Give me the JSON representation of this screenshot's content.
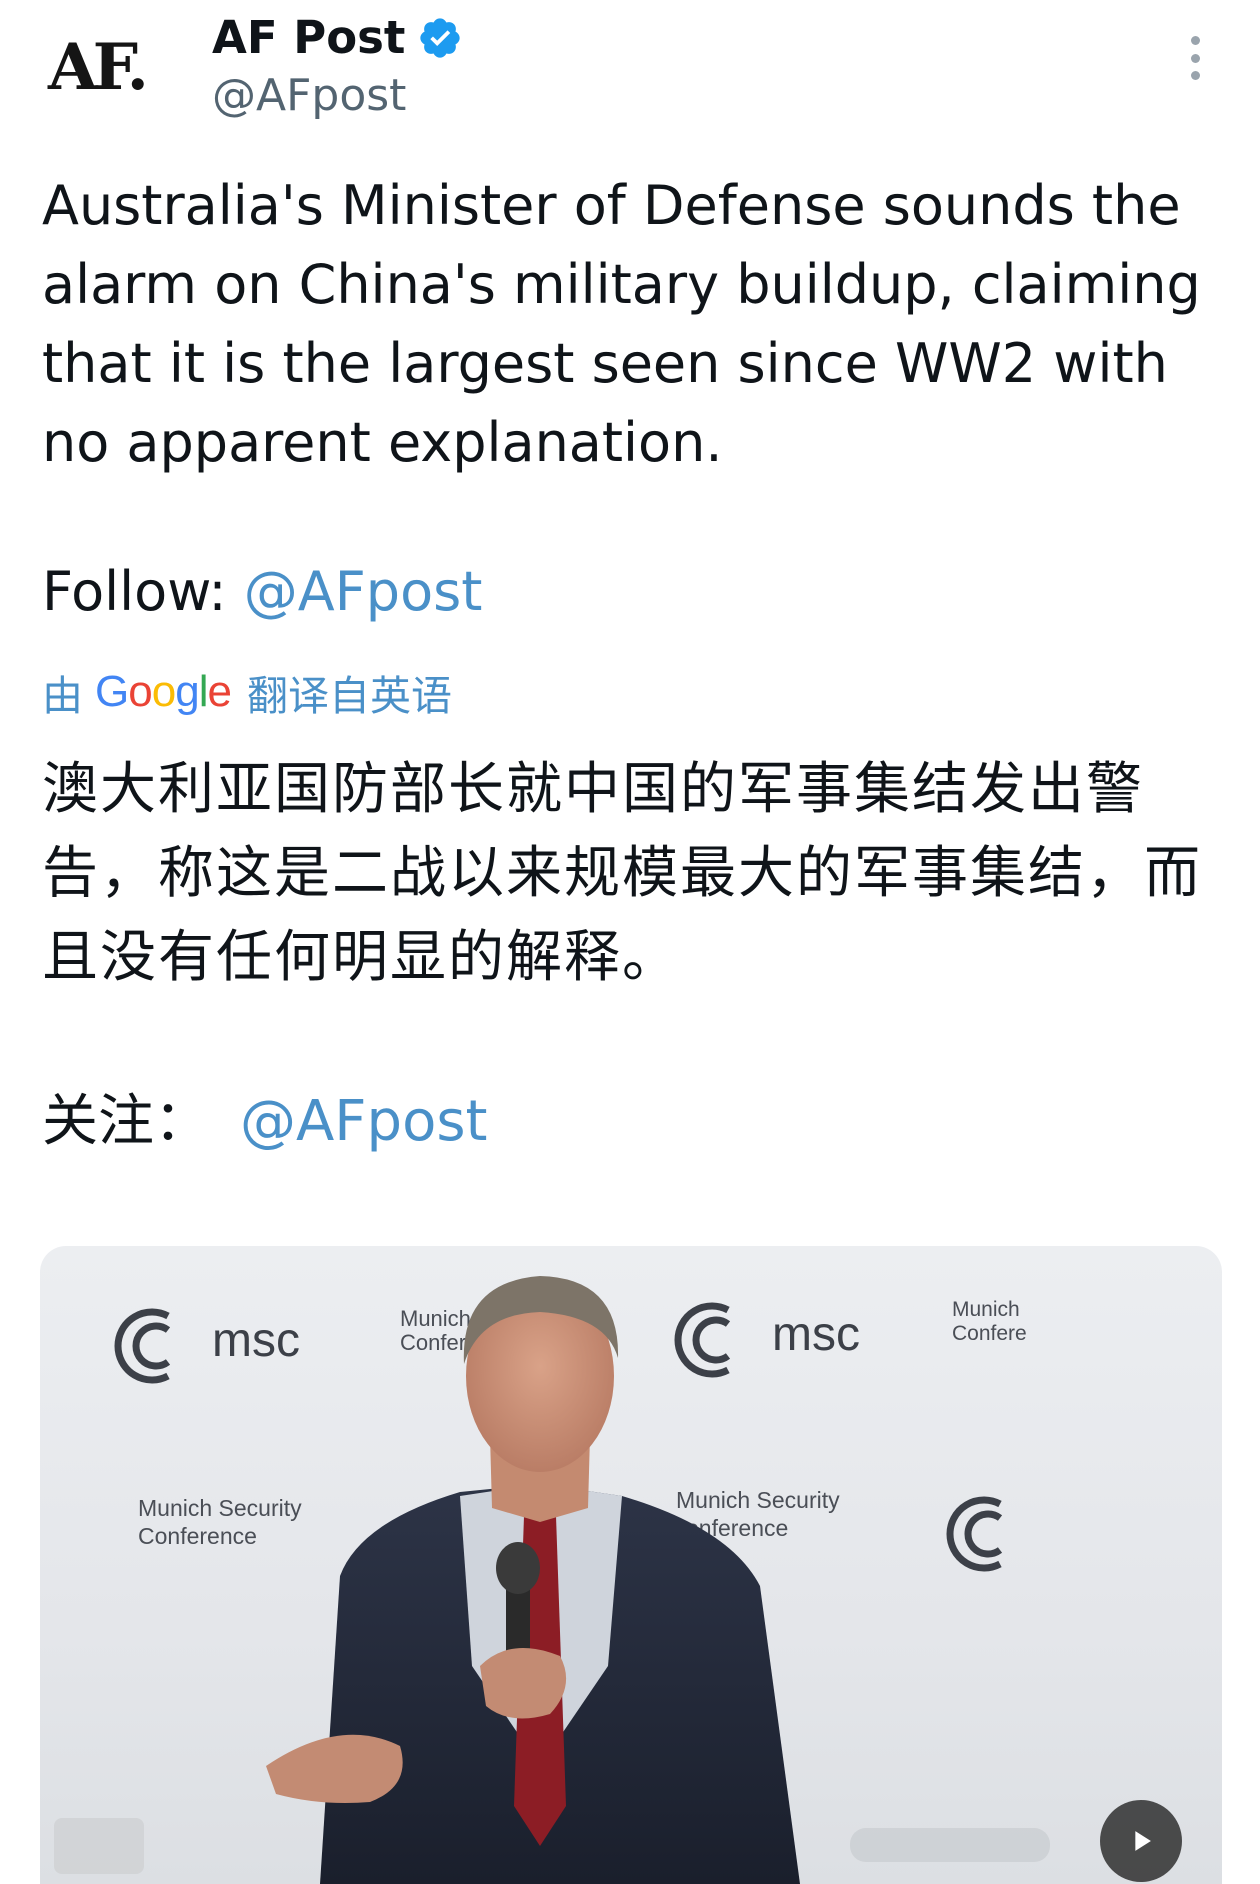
{
  "header": {
    "logo_text": "AF.",
    "display_name": "AF Post",
    "handle": "@AFpost"
  },
  "tweet": {
    "text": "Australia's Minister of Defense sounds the alarm on China's military buildup, claiming that it is the largest seen since WW2 with no apparent explanation.",
    "follow_label": "Follow: ",
    "follow_handle": "@AFpost"
  },
  "translation": {
    "prefix": "由",
    "provider": "Google",
    "suffix": "翻译自英语",
    "text": "澳大利亚国防部长就中国的军事集结发出警告，称这是二战以来规模最大的军事集结，而且没有任何明显的解释。",
    "follow_label": "关注：",
    "follow_handle": "@AFpost"
  },
  "media": {
    "backdrop_brand": "msc",
    "backdrop_lines": [
      "Munich Security",
      "Conference"
    ],
    "partial_labels": {
      "top_center_1": "Munich",
      "top_center_2": "Confer",
      "top_right_1": "Munich",
      "top_right_2": "Confere",
      "mid_right_1": "Munich Security",
      "mid_right_2": "onference"
    }
  },
  "colors": {
    "link": "#4a90c8",
    "verified": "#1d9bf0",
    "text": "#0f1419",
    "muted": "#536471"
  },
  "icons": {
    "verified": "verified-badge-icon",
    "more": "more-vertical-icon",
    "play": "play-icon"
  }
}
